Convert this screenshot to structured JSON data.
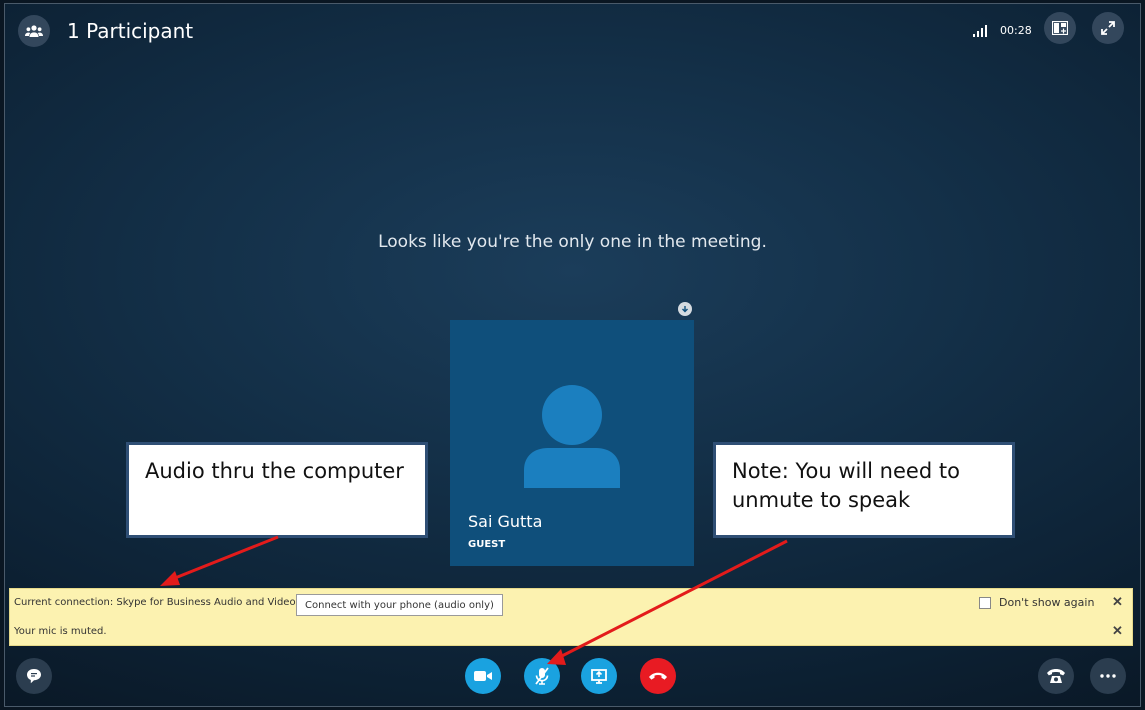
{
  "header": {
    "participants_label": "1 Participant",
    "timer": "00:28",
    "icons": [
      "participants-icon",
      "signal-icon",
      "layout-icon",
      "fullscreen-icon"
    ]
  },
  "stage": {
    "empty_message": "Looks like you're the only one in the meeting."
  },
  "participant": {
    "name": "Sai Gutta",
    "role": "GUEST",
    "tile_color": "#0f4f7b"
  },
  "callouts": {
    "left": "Audio thru the computer",
    "right": "Note: You will need to unmute to speak"
  },
  "notification": {
    "connection_text": "Current connection: Skype for Business Audio and Video",
    "phone_button": "Connect with your phone (audio only)",
    "dont_show_label": "Don't show again",
    "dont_show_checked": false,
    "mic_muted_text": "Your mic is muted.",
    "background": "#fcf2b0"
  },
  "controls": {
    "accent": "#1aa2e0",
    "end_call_color": "#e81b23",
    "buttons": [
      "chat-icon",
      "video-icon",
      "mic-muted-icon",
      "share-screen-icon",
      "end-call-icon",
      "dialpad-icon",
      "more-icon"
    ]
  }
}
